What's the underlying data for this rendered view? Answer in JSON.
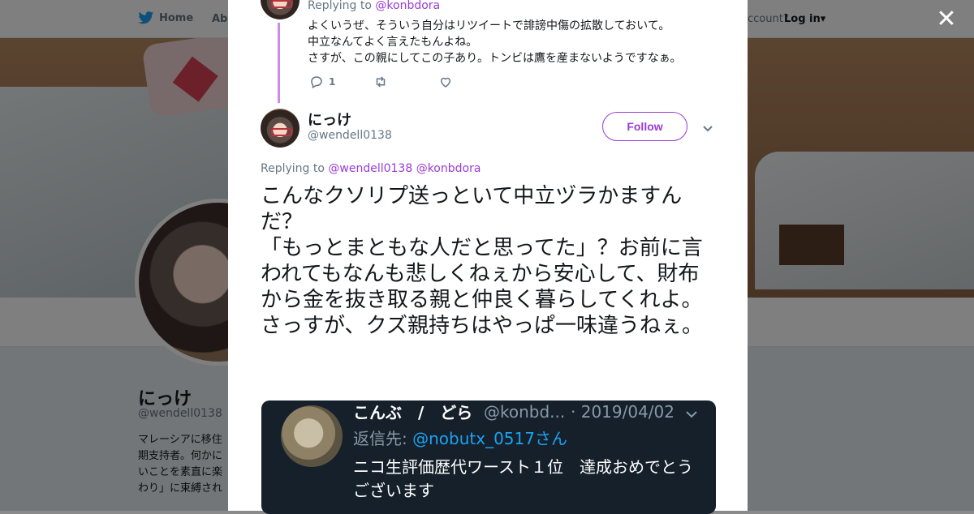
{
  "topbar": {
    "home_label": "Home",
    "about_label": "Abo",
    "account_prompt": "ccount?",
    "login_label": "Log in"
  },
  "profile": {
    "name": "にっけ",
    "handle": "@wendell0138",
    "bio": "マレーシアに移住期支持者。何かにいことを素直に楽わり」に束縛され"
  },
  "modal": {
    "close_label": "✕",
    "prev_tweet": {
      "replying_prefix": "Replying to",
      "replying_to": "@konbdora",
      "lines": [
        "よくいうぜ、そういう自分はリツイートで誹謗中傷の拡散しておいて。",
        "中立なんてよく言えたもんよね。",
        "さすが、この親にしてこの子あり。トンビは鷹を産まないようですなぁ。"
      ],
      "reply_count": "1"
    },
    "main_tweet": {
      "name": "にっけ",
      "handle": "@wendell0138",
      "follow_label": "Follow",
      "replying_prefix": "Replying to",
      "replying_to_1": "@wendell0138",
      "replying_to_2": "@konbdora",
      "text": "こんなクソリプ送っといて中立ヅラかますんだ？\n「もっとまともな人だと思ってた」？お前に言われてもなんも悲しくねぇから安心して、財布から金を抜き取る親と仲良く暮らしてくれよ。\nさっすが、クズ親持ちはやっぱ一味違うねぇ。"
    },
    "embedded_image": {
      "name": "こんぶ　/　どら",
      "handle": "@konbd...",
      "date": "· 2019/04/02",
      "reply_prefix": "返信先:",
      "reply_to": "@nobutx_0517さん",
      "body": "ニコ生評価歴代ワースト１位　達成おめでとうございます"
    }
  },
  "colors": {
    "accent": "#9b3bd4",
    "thread_line": "#cc8be8",
    "text_primary": "#14171a",
    "text_secondary": "#657786",
    "embedded_bg": "#15202b",
    "embedded_link": "#1da1f2"
  },
  "icons": [
    "twitter-bird-icon",
    "close-icon",
    "reply-icon",
    "retweet-icon",
    "like-icon",
    "chevron-down-icon"
  ]
}
